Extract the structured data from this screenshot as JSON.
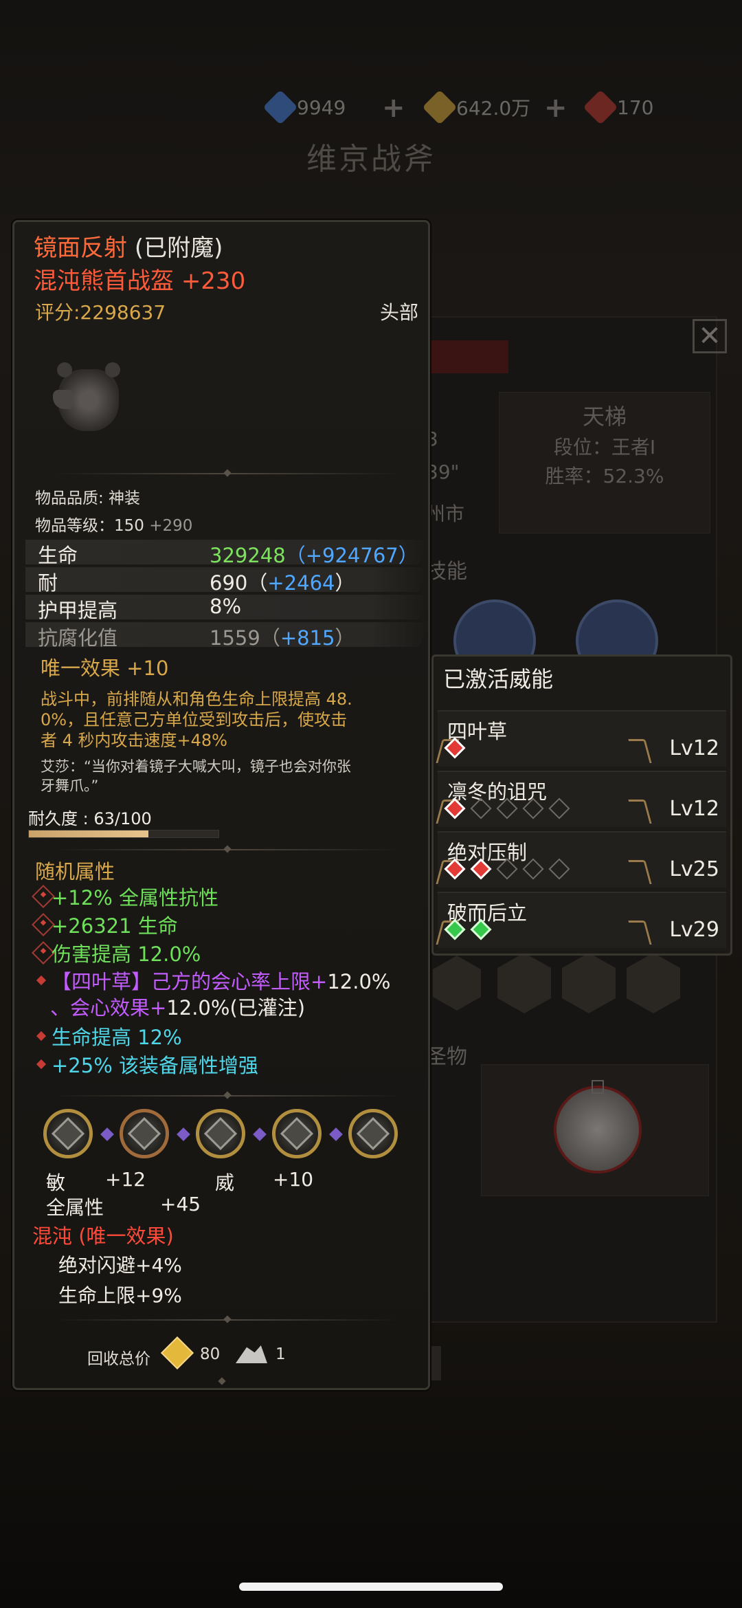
{
  "background": {
    "resources": [
      {
        "icon": "blue-gem-icon",
        "value": "9949"
      },
      {
        "icon": "gold-coin-icon",
        "value": "642.0万"
      },
      {
        "icon": "red-crystal-icon",
        "value": "170"
      }
    ],
    "title": "维京战斧",
    "ladder": {
      "title": "天梯",
      "rank": "段位：王者I",
      "winrate": "胜率：52.3%"
    },
    "partial_info": [
      "3",
      "39\"",
      "州市"
    ],
    "skills_label_partial": "技能",
    "relic_label_partial": "圣物"
  },
  "tooltip": {
    "enchant_name": "镜面反射",
    "enchant_status": "(已附魔)",
    "item_name": "混沌熊首战盔",
    "item_plus": "+230",
    "score": "评分:2298637",
    "slot": "头部",
    "quality": "物品品质: 神装",
    "level_label": "物品等级：",
    "level_value": "150",
    "level_bonus": "+290",
    "stats": [
      {
        "name": "生命",
        "base": "329248",
        "open": "（",
        "bonus": "+924767",
        "close": "）"
      },
      {
        "name": "耐",
        "base": "690",
        "open": "（",
        "bonus": "+2464",
        "close": "）"
      },
      {
        "name": "护甲提高",
        "base": "8%"
      },
      {
        "name": "抗腐化值",
        "base": "1559",
        "open": "（",
        "bonus": "+815",
        "close": "）"
      }
    ],
    "unique_title": "唯一效果",
    "unique_plus": "+10",
    "unique_desc_1": "战斗中，前排随从和角色生命上限提高 48.",
    "unique_desc_2": "0%，且任意己方单位受到攻击后，使攻击",
    "unique_desc_3": "者 4 秒内攻击速度+48%",
    "quote_1": "艾莎：“当你对着镜子大喊大叫，镜子也会对你张",
    "quote_2": "牙舞爪。”",
    "durability_label": "耐久度 : 63/100",
    "durability_fraction": 0.63,
    "random_title": "随机属性",
    "random_attrs": [
      "+12% 全属性抗性",
      "+26321 生命",
      "伤害提高 12.0%"
    ],
    "special_attr_tag": "【四叶草】",
    "special_attr_text1": "己方的会心率上限+",
    "special_attr_val1": "12.0%",
    "special_attr_text2": "、会心效果+",
    "special_attr_val2": "12.0%(已灌注)",
    "extra_attrs": [
      "生命提高 12%",
      "+25% 该装备属性增强"
    ],
    "rune_stats": {
      "a_name": "敏",
      "a_val": "+12",
      "b_name": "威",
      "b_val": "+10",
      "c_name": "全属性",
      "c_val": "+45"
    },
    "chaos_title": "混沌 (唯一效果)",
    "chaos_effects": [
      "绝对闪避+4%",
      "生命上限+9%"
    ],
    "recycle_label": "回收总价",
    "recycle_gold": "80",
    "recycle_dust": "1"
  },
  "powers": {
    "title": "已激活威能",
    "items": [
      {
        "name": "四叶草",
        "level": "Lv12",
        "pips": [
          "r"
        ]
      },
      {
        "name": "凛冬的诅咒",
        "level": "Lv12",
        "pips": [
          "r",
          "e",
          "e",
          "e",
          "e"
        ]
      },
      {
        "name": "绝对压制",
        "level": "Lv25",
        "pips": [
          "r",
          "r",
          "e",
          "e",
          "e"
        ]
      },
      {
        "name": "破而后立",
        "level": "Lv29",
        "pips": [
          "g",
          "g"
        ]
      }
    ]
  },
  "colors": {
    "enchant": "#ff6a3a",
    "item": "#ff5a3a",
    "gold": "#d8a84a",
    "green": "#6ee05a",
    "blue": "#4fa7ff",
    "purple": "#c35cff"
  }
}
